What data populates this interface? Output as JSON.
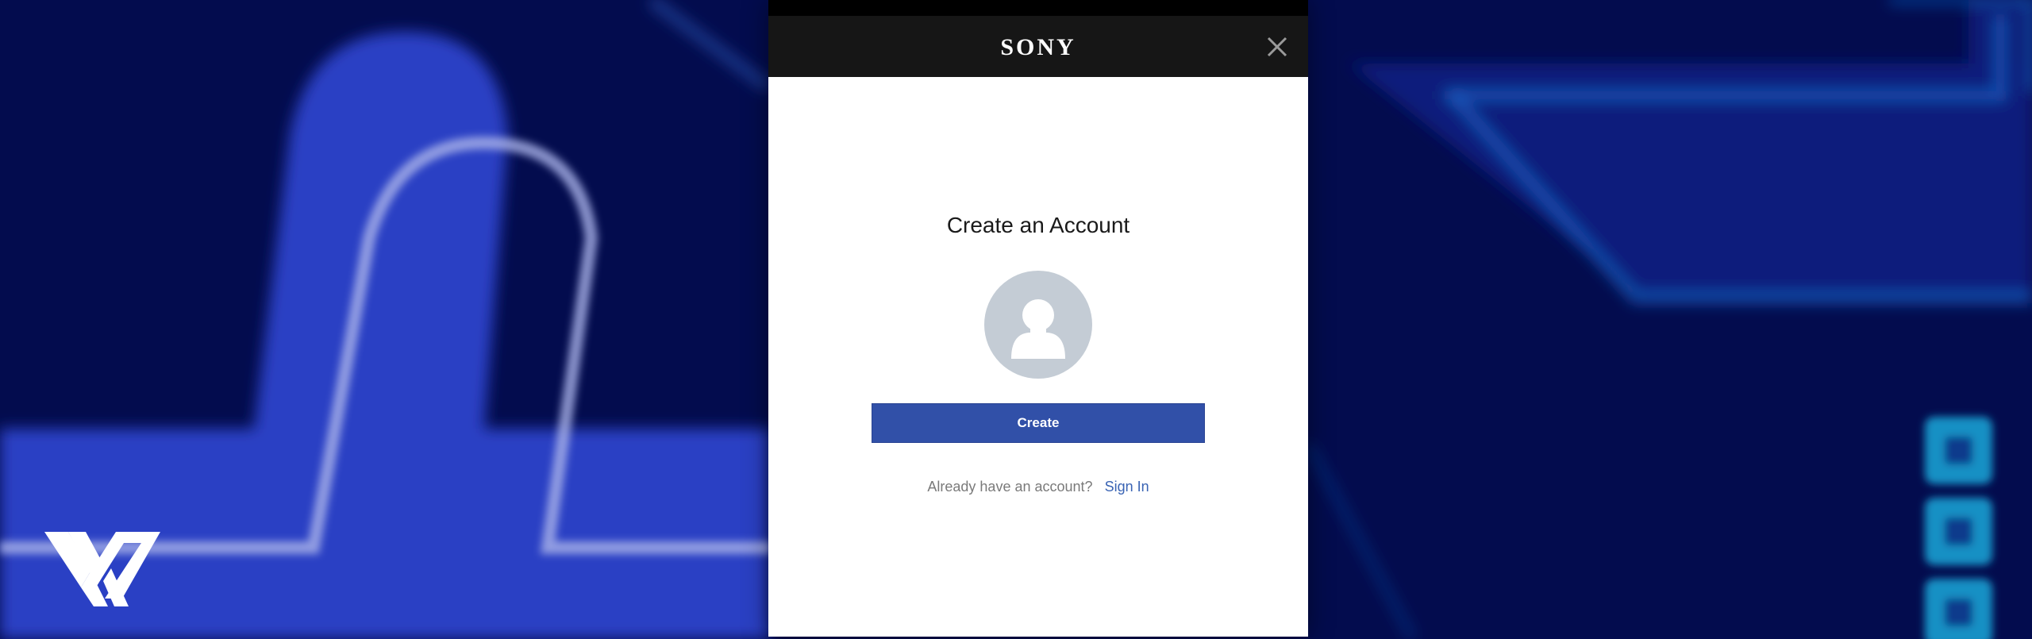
{
  "header": {
    "brand": "SONY",
    "close_icon": "close-icon"
  },
  "dialog": {
    "title": "Create an Account",
    "avatar_icon": "user-silhouette-icon",
    "create_button_label": "Create",
    "signin_prompt": "Already have an account?",
    "signin_link_label": "Sign In"
  },
  "background": {
    "logo_icon": "w-logo-icon"
  },
  "colors": {
    "background_navy": "#030c4e",
    "header_bar": "#161616",
    "primary_button": "#3150a8",
    "link": "#3a64b4",
    "avatar_bg": "#c4ccd5"
  }
}
